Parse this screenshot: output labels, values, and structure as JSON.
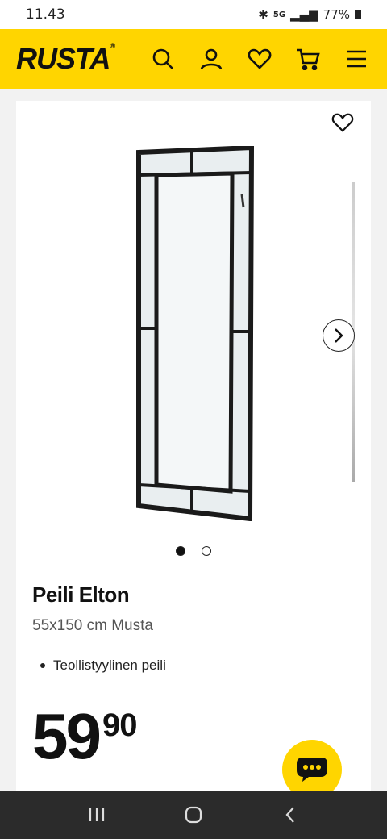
{
  "status": {
    "time": "11.43",
    "battery": "77%",
    "network": "5G"
  },
  "header": {
    "logo": "RUSTA",
    "logo_mark": "®",
    "brand_color": "#ffd500"
  },
  "product": {
    "title": "Peili Elton",
    "subtitle": "55x150 cm Musta",
    "features": [
      "Teollistyylinen peili"
    ],
    "price_main": "59",
    "price_cents": "90",
    "image_count": 2,
    "active_image": 1
  },
  "icons": {
    "header": [
      "search-icon",
      "account-icon",
      "heart-icon",
      "cart-icon",
      "menu-icon"
    ],
    "nav": [
      "recent-apps-icon",
      "home-icon",
      "back-icon"
    ]
  }
}
